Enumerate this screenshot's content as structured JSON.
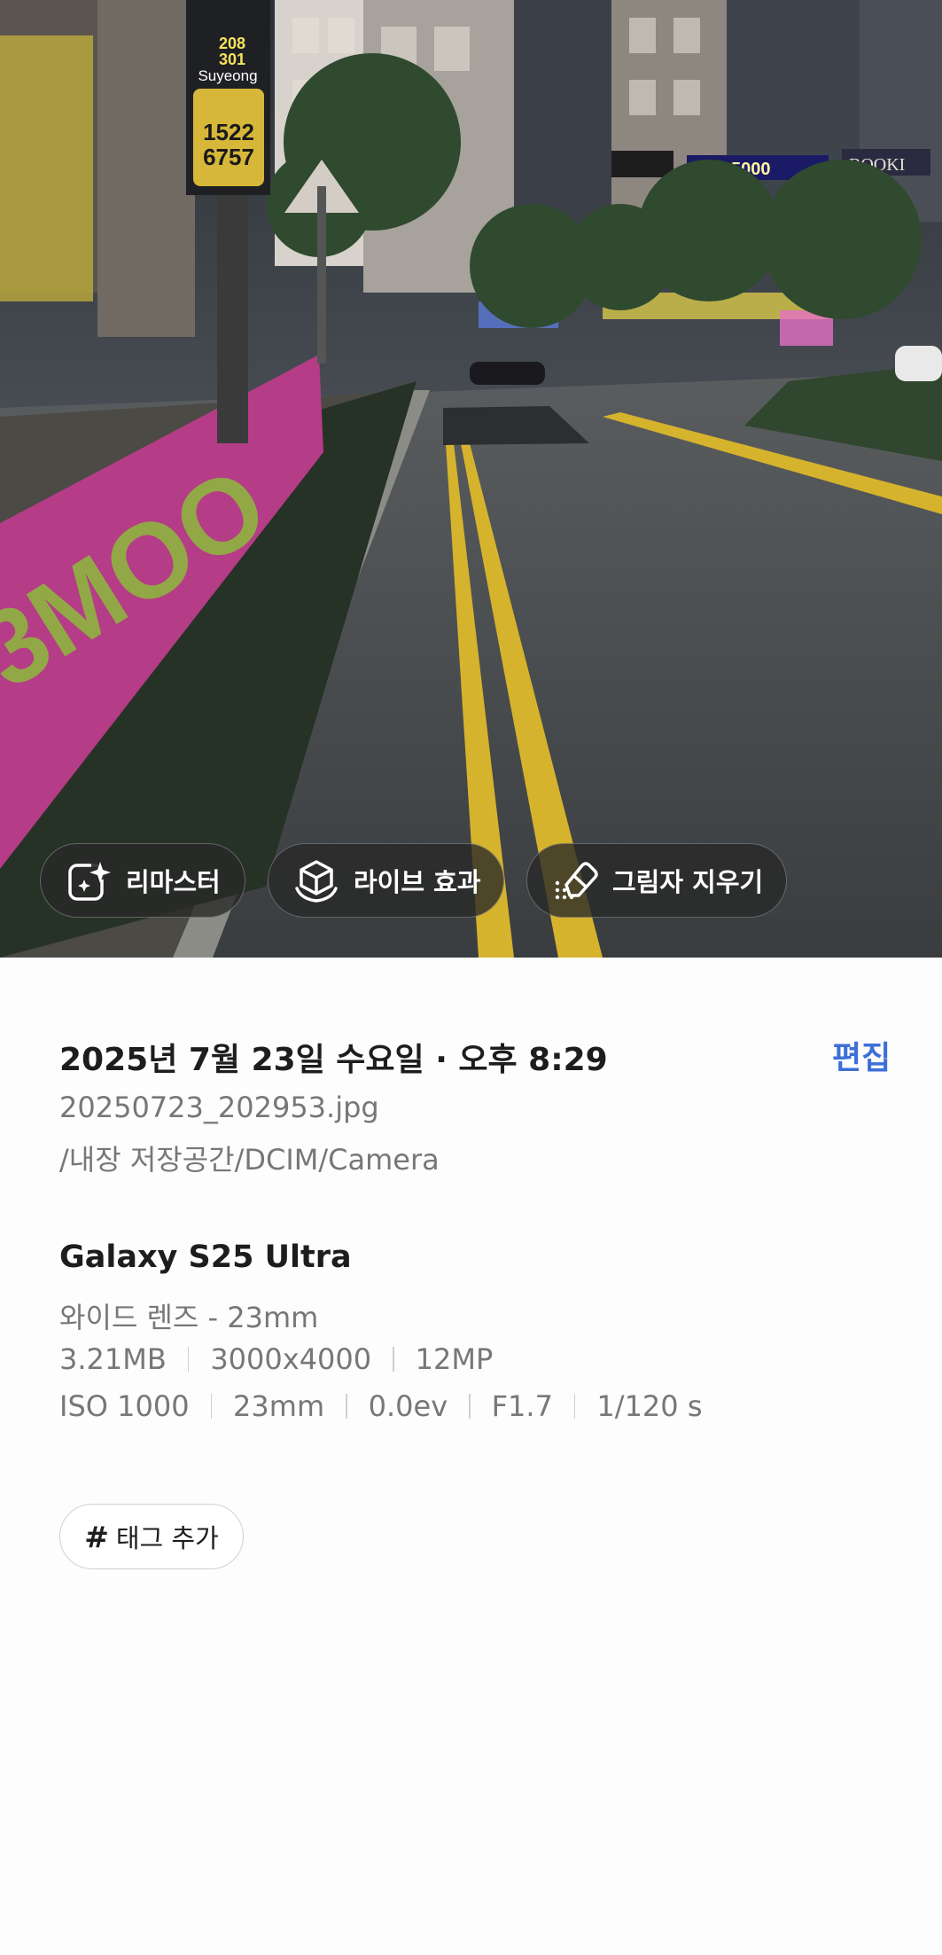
{
  "photo": {
    "sign_lines": [
      "208",
      "301"
    ],
    "sign_brand": "Suyeong",
    "sign_phone_top": "1522",
    "sign_phone_bottom": "6757",
    "store_sign": "555·5000",
    "book_sign": "BOOKI"
  },
  "actions": {
    "remaster_label": "리마스터",
    "live_label": "라이브 효과",
    "shadow_label": "그림자 지우기"
  },
  "details": {
    "date_time": "2025년 7월 23일 수요일 · 오후 8:29",
    "edit_label": "편집",
    "filename": "20250723_202953.jpg",
    "path": "/내장 저장공간/DCIM/Camera",
    "device": "Galaxy S25 Ultra",
    "lens": "와이드 렌즈 - 23mm",
    "file_specs": [
      "3.21MB",
      "3000x4000",
      "12MP"
    ],
    "exposure_specs": [
      "ISO 1000",
      "23mm",
      "0.0ev",
      "F1.7",
      "1/120 s"
    ],
    "tag_label": "태그 추가",
    "tag_icon": "#"
  },
  "colors": {
    "accent": "#3d6fd6"
  }
}
